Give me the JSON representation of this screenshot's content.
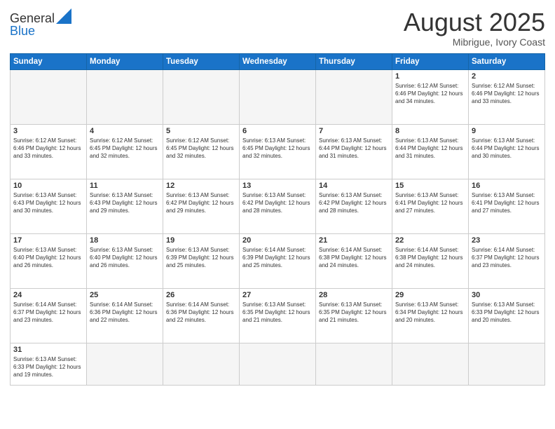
{
  "header": {
    "logo_general": "General",
    "logo_blue": "Blue",
    "month_title": "August 2025",
    "location": "Mibrigue, Ivory Coast"
  },
  "days_of_week": [
    "Sunday",
    "Monday",
    "Tuesday",
    "Wednesday",
    "Thursday",
    "Friday",
    "Saturday"
  ],
  "weeks": [
    [
      {
        "day": "",
        "info": ""
      },
      {
        "day": "",
        "info": ""
      },
      {
        "day": "",
        "info": ""
      },
      {
        "day": "",
        "info": ""
      },
      {
        "day": "",
        "info": ""
      },
      {
        "day": "1",
        "info": "Sunrise: 6:12 AM\nSunset: 6:46 PM\nDaylight: 12 hours and 34 minutes."
      },
      {
        "day": "2",
        "info": "Sunrise: 6:12 AM\nSunset: 6:46 PM\nDaylight: 12 hours and 33 minutes."
      }
    ],
    [
      {
        "day": "3",
        "info": "Sunrise: 6:12 AM\nSunset: 6:46 PM\nDaylight: 12 hours and 33 minutes."
      },
      {
        "day": "4",
        "info": "Sunrise: 6:12 AM\nSunset: 6:45 PM\nDaylight: 12 hours and 32 minutes."
      },
      {
        "day": "5",
        "info": "Sunrise: 6:12 AM\nSunset: 6:45 PM\nDaylight: 12 hours and 32 minutes."
      },
      {
        "day": "6",
        "info": "Sunrise: 6:13 AM\nSunset: 6:45 PM\nDaylight: 12 hours and 32 minutes."
      },
      {
        "day": "7",
        "info": "Sunrise: 6:13 AM\nSunset: 6:44 PM\nDaylight: 12 hours and 31 minutes."
      },
      {
        "day": "8",
        "info": "Sunrise: 6:13 AM\nSunset: 6:44 PM\nDaylight: 12 hours and 31 minutes."
      },
      {
        "day": "9",
        "info": "Sunrise: 6:13 AM\nSunset: 6:44 PM\nDaylight: 12 hours and 30 minutes."
      }
    ],
    [
      {
        "day": "10",
        "info": "Sunrise: 6:13 AM\nSunset: 6:43 PM\nDaylight: 12 hours and 30 minutes."
      },
      {
        "day": "11",
        "info": "Sunrise: 6:13 AM\nSunset: 6:43 PM\nDaylight: 12 hours and 29 minutes."
      },
      {
        "day": "12",
        "info": "Sunrise: 6:13 AM\nSunset: 6:42 PM\nDaylight: 12 hours and 29 minutes."
      },
      {
        "day": "13",
        "info": "Sunrise: 6:13 AM\nSunset: 6:42 PM\nDaylight: 12 hours and 28 minutes."
      },
      {
        "day": "14",
        "info": "Sunrise: 6:13 AM\nSunset: 6:42 PM\nDaylight: 12 hours and 28 minutes."
      },
      {
        "day": "15",
        "info": "Sunrise: 6:13 AM\nSunset: 6:41 PM\nDaylight: 12 hours and 27 minutes."
      },
      {
        "day": "16",
        "info": "Sunrise: 6:13 AM\nSunset: 6:41 PM\nDaylight: 12 hours and 27 minutes."
      }
    ],
    [
      {
        "day": "17",
        "info": "Sunrise: 6:13 AM\nSunset: 6:40 PM\nDaylight: 12 hours and 26 minutes."
      },
      {
        "day": "18",
        "info": "Sunrise: 6:13 AM\nSunset: 6:40 PM\nDaylight: 12 hours and 26 minutes."
      },
      {
        "day": "19",
        "info": "Sunrise: 6:13 AM\nSunset: 6:39 PM\nDaylight: 12 hours and 25 minutes."
      },
      {
        "day": "20",
        "info": "Sunrise: 6:14 AM\nSunset: 6:39 PM\nDaylight: 12 hours and 25 minutes."
      },
      {
        "day": "21",
        "info": "Sunrise: 6:14 AM\nSunset: 6:38 PM\nDaylight: 12 hours and 24 minutes."
      },
      {
        "day": "22",
        "info": "Sunrise: 6:14 AM\nSunset: 6:38 PM\nDaylight: 12 hours and 24 minutes."
      },
      {
        "day": "23",
        "info": "Sunrise: 6:14 AM\nSunset: 6:37 PM\nDaylight: 12 hours and 23 minutes."
      }
    ],
    [
      {
        "day": "24",
        "info": "Sunrise: 6:14 AM\nSunset: 6:37 PM\nDaylight: 12 hours and 23 minutes."
      },
      {
        "day": "25",
        "info": "Sunrise: 6:14 AM\nSunset: 6:36 PM\nDaylight: 12 hours and 22 minutes."
      },
      {
        "day": "26",
        "info": "Sunrise: 6:14 AM\nSunset: 6:36 PM\nDaylight: 12 hours and 22 minutes."
      },
      {
        "day": "27",
        "info": "Sunrise: 6:13 AM\nSunset: 6:35 PM\nDaylight: 12 hours and 21 minutes."
      },
      {
        "day": "28",
        "info": "Sunrise: 6:13 AM\nSunset: 6:35 PM\nDaylight: 12 hours and 21 minutes."
      },
      {
        "day": "29",
        "info": "Sunrise: 6:13 AM\nSunset: 6:34 PM\nDaylight: 12 hours and 20 minutes."
      },
      {
        "day": "30",
        "info": "Sunrise: 6:13 AM\nSunset: 6:33 PM\nDaylight: 12 hours and 20 minutes."
      }
    ],
    [
      {
        "day": "31",
        "info": "Sunrise: 6:13 AM\nSunset: 6:33 PM\nDaylight: 12 hours and 19 minutes."
      },
      {
        "day": "",
        "info": ""
      },
      {
        "day": "",
        "info": ""
      },
      {
        "day": "",
        "info": ""
      },
      {
        "day": "",
        "info": ""
      },
      {
        "day": "",
        "info": ""
      },
      {
        "day": "",
        "info": ""
      }
    ]
  ]
}
